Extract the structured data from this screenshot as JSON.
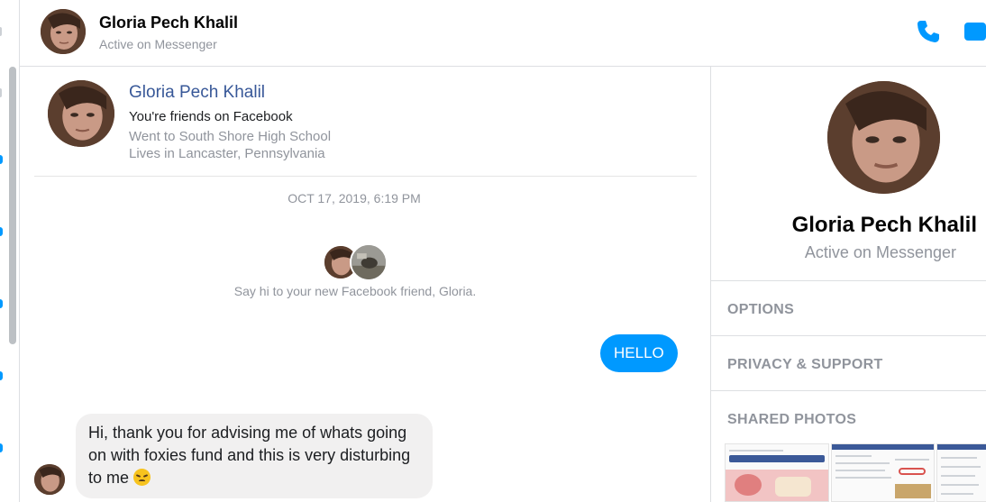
{
  "header": {
    "name": "Gloria Pech Khalil",
    "status": "Active on Messenger",
    "call_icon": "phone-icon",
    "video_icon": "video-camera-icon"
  },
  "intro": {
    "name": "Gloria Pech Khalil",
    "friends_text": "You're friends on Facebook",
    "school": "Went to South Shore High School",
    "lives": "Lives in Lancaster, Pennsylvania"
  },
  "conversation": {
    "timestamp": "OCT 17, 2019, 6:19 PM",
    "new_friend_text": "Say hi to your new Facebook friend, Gloria.",
    "messages": [
      {
        "direction": "outgoing",
        "text": "HELLO"
      },
      {
        "direction": "incoming",
        "text": "Hi, thank you for advising me of whats going on with foxies fund and this is very disturbing to me",
        "emoji": "disappointed-face"
      }
    ]
  },
  "panel": {
    "name": "Gloria Pech Khalil",
    "status": "Active on Messenger",
    "sections": [
      "OPTIONS",
      "PRIVACY & SUPPORT",
      "SHARED PHOTOS"
    ]
  },
  "colors": {
    "accent": "#0099ff",
    "link": "#385898",
    "muted": "#90949c",
    "incoming_bubble": "#f1f0f0"
  }
}
